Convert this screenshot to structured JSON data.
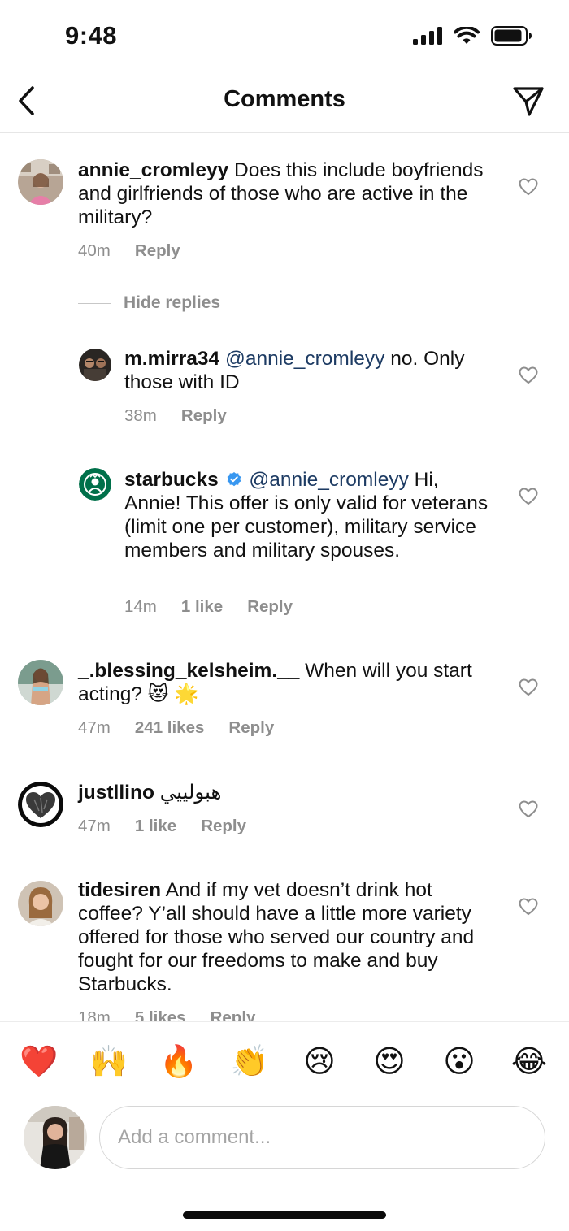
{
  "status_bar": {
    "time": "9:48"
  },
  "header": {
    "title": "Comments"
  },
  "hide_replies_label": "Hide replies",
  "comments": [
    {
      "username": "annie_cromleyy",
      "text": " Does this include boyfriends and girlfriends of those who are active in the military?",
      "time": "40m",
      "reply": "Reply"
    },
    {
      "username": "m.mirra34",
      "mention": "@annie_cromleyy",
      "text": " no. Only those with ID",
      "time": "38m",
      "reply": "Reply"
    },
    {
      "username": "starbucks",
      "verified": true,
      "mention": "@annie_cromleyy",
      "text": "  Hi, Annie! This offer is only valid for veterans (limit one per customer), military service members and military spouses.",
      "time": "14m",
      "likes": "1 like",
      "reply": "Reply"
    },
    {
      "username": "_.blessing_kelsheim.__",
      "text": " When will you start acting? 😻 🌟",
      "time": "47m",
      "likes": "241 likes",
      "reply": "Reply"
    },
    {
      "username": "justllino",
      "text": " هبولييي",
      "time": "47m",
      "likes": "1 like",
      "reply": "Reply"
    },
    {
      "username": "tidesiren",
      "text": " And if my vet doesn’t drink hot coffee? Y’all should have a little more variety offered for those who served our country and fought for our freedoms to make and buy Starbucks.",
      "time": "18m",
      "likes": "5 likes",
      "reply": "Reply"
    }
  ],
  "emoji_bar": [
    "❤️",
    "🙌",
    "🔥",
    "👏",
    "😢",
    "😍",
    "😮",
    "😂"
  ],
  "composer": {
    "placeholder": "Add a comment..."
  },
  "icons": {
    "back": "chevron-left-icon",
    "share": "paper-plane-icon",
    "like": "heart-outline-icon",
    "verified": "verified-badge-icon"
  },
  "colors": {
    "mention": "#1d3b63",
    "verified": "#3897f0",
    "meta": "#8e8e8e"
  }
}
